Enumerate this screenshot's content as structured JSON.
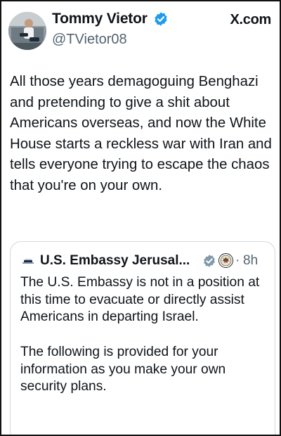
{
  "post": {
    "author_name": "Tommy Vietor",
    "author_handle": "@TVietor08",
    "site_label": "X.com",
    "text": "All those years demagoguing Benghazi and pretending to give a shit about Americans overseas, and now the White House starts a reckless war with Iran and tells everyone trying to escape the chaos that you're on your own."
  },
  "quoted_post": {
    "author_name": "U.S. Embassy Jerusal...",
    "separator": "·",
    "time": "8h",
    "paragraphs": [
      "The U.S. Embassy is not in a position at this time to evacuate or directly assist Americans in departing Israel.",
      "The following is provided for your information as you make your own security plans."
    ]
  },
  "colors": {
    "verified_blue": "#1d9bf0",
    "verified_gray": "#829aab",
    "secondary_text": "#536471",
    "border": "#cfd9de"
  },
  "icons": {
    "author_verified": "verified-badge-icon",
    "quote_verified": "gray-verified-badge-icon",
    "quote_affiliation": "us-seal-icon"
  }
}
